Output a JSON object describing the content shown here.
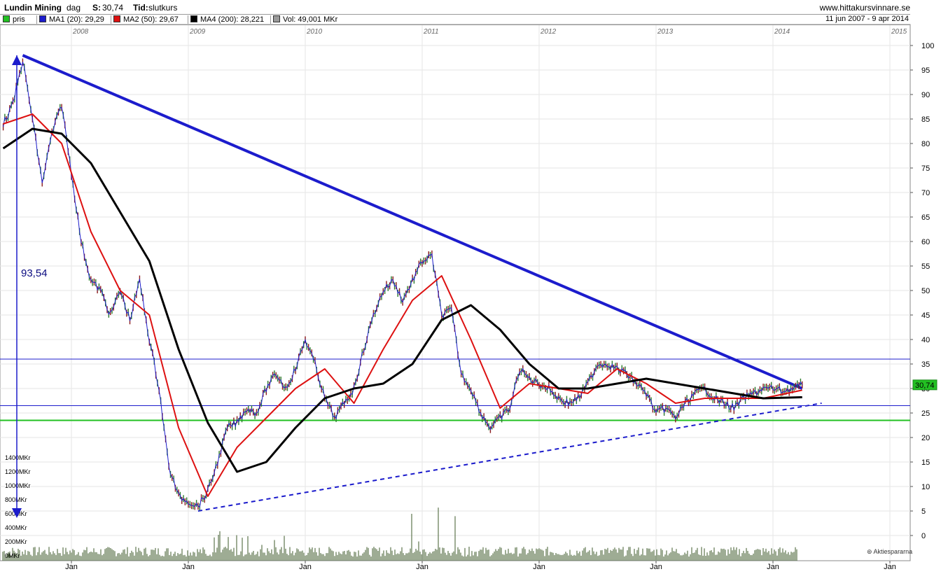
{
  "header": {
    "stock": "Lundin Mining",
    "period": "dag",
    "s_label": "S:",
    "s_value": "30,74",
    "tid_label": "Tid:",
    "tid_value": "slutkurs",
    "site": "www.hittakursvinnare.se",
    "date_range": "11 jun 2007 - 9 apr 2014"
  },
  "legend": [
    {
      "label": "pris",
      "color": "#22c022"
    },
    {
      "label": "MA1 (20): 29,29",
      "color": "#1c1ccc"
    },
    {
      "label": "MA2 (50): 29,67",
      "color": "#dd1111"
    },
    {
      "label": "MA4 (200): 28,221",
      "color": "#000000"
    },
    {
      "label": "Vol: 49,001 MKr",
      "color": "#9a9a9a"
    }
  ],
  "chart_data": {
    "type": "line",
    "title": "Lundin Mining",
    "y_axis": {
      "range": [
        0,
        100
      ],
      "ticks": [
        0,
        5,
        10,
        15,
        20,
        25,
        30,
        35,
        40,
        45,
        50,
        55,
        60,
        65,
        70,
        75,
        80,
        85,
        90,
        95,
        100
      ],
      "side": "right"
    },
    "year_labels": [
      "2008",
      "2009",
      "2010",
      "2011",
      "2012",
      "2013",
      "2014",
      "2015"
    ],
    "month_labels": [
      "Jan",
      "Jan",
      "Jan",
      "Jan",
      "Jan",
      "Jan",
      "Jan",
      "Jan"
    ],
    "volume_axis_labels": [
      "0MKr",
      "200MKr",
      "400MKr",
      "600MKr",
      "800MKr",
      "1000MKr",
      "1200MKr",
      "1400MKr"
    ],
    "last_price_label": "30,74",
    "measure_label": "93,54",
    "footer_brand": "Aktiespararna",
    "price_series": [
      {
        "x": "2007-06",
        "y": 84
      },
      {
        "x": "2007-07",
        "y": 88
      },
      {
        "x": "2007-08",
        "y": 97
      },
      {
        "x": "2007-09",
        "y": 85
      },
      {
        "x": "2007-10",
        "y": 72
      },
      {
        "x": "2007-11",
        "y": 82
      },
      {
        "x": "2007-12",
        "y": 88
      },
      {
        "x": "2008-01",
        "y": 74
      },
      {
        "x": "2008-02",
        "y": 60
      },
      {
        "x": "2008-03",
        "y": 52
      },
      {
        "x": "2008-04",
        "y": 50
      },
      {
        "x": "2008-05",
        "y": 45
      },
      {
        "x": "2008-06",
        "y": 50
      },
      {
        "x": "2008-07",
        "y": 44
      },
      {
        "x": "2008-08",
        "y": 52
      },
      {
        "x": "2008-09",
        "y": 40
      },
      {
        "x": "2008-10",
        "y": 30
      },
      {
        "x": "2008-11",
        "y": 14
      },
      {
        "x": "2008-12",
        "y": 8
      },
      {
        "x": "2009-01",
        "y": 7
      },
      {
        "x": "2009-02",
        "y": 6
      },
      {
        "x": "2009-03",
        "y": 9
      },
      {
        "x": "2009-04",
        "y": 15
      },
      {
        "x": "2009-05",
        "y": 22
      },
      {
        "x": "2009-06",
        "y": 23
      },
      {
        "x": "2009-07",
        "y": 26
      },
      {
        "x": "2009-08",
        "y": 25
      },
      {
        "x": "2009-09",
        "y": 30
      },
      {
        "x": "2009-10",
        "y": 33
      },
      {
        "x": "2009-11",
        "y": 30
      },
      {
        "x": "2009-12",
        "y": 34
      },
      {
        "x": "2010-01",
        "y": 40
      },
      {
        "x": "2010-02",
        "y": 35
      },
      {
        "x": "2010-03",
        "y": 28
      },
      {
        "x": "2010-04",
        "y": 24
      },
      {
        "x": "2010-05",
        "y": 27
      },
      {
        "x": "2010-06",
        "y": 30
      },
      {
        "x": "2010-07",
        "y": 38
      },
      {
        "x": "2010-08",
        "y": 45
      },
      {
        "x": "2010-09",
        "y": 50
      },
      {
        "x": "2010-10",
        "y": 52
      },
      {
        "x": "2010-11",
        "y": 48
      },
      {
        "x": "2010-12",
        "y": 52
      },
      {
        "x": "2011-01",
        "y": 56
      },
      {
        "x": "2011-02",
        "y": 57
      },
      {
        "x": "2011-03",
        "y": 45
      },
      {
        "x": "2011-04",
        "y": 46
      },
      {
        "x": "2011-05",
        "y": 33
      },
      {
        "x": "2011-06",
        "y": 30
      },
      {
        "x": "2011-07",
        "y": 25
      },
      {
        "x": "2011-08",
        "y": 22
      },
      {
        "x": "2011-09",
        "y": 24
      },
      {
        "x": "2011-10",
        "y": 26
      },
      {
        "x": "2011-11",
        "y": 34
      },
      {
        "x": "2011-12",
        "y": 32
      },
      {
        "x": "2012-01",
        "y": 31
      },
      {
        "x": "2012-02",
        "y": 30
      },
      {
        "x": "2012-03",
        "y": 28
      },
      {
        "x": "2012-04",
        "y": 27
      },
      {
        "x": "2012-05",
        "y": 28
      },
      {
        "x": "2012-06",
        "y": 31
      },
      {
        "x": "2012-07",
        "y": 35
      },
      {
        "x": "2012-08",
        "y": 35
      },
      {
        "x": "2012-09",
        "y": 34
      },
      {
        "x": "2012-10",
        "y": 33
      },
      {
        "x": "2012-11",
        "y": 31
      },
      {
        "x": "2012-12",
        "y": 29
      },
      {
        "x": "2013-01",
        "y": 25
      },
      {
        "x": "2013-02",
        "y": 26
      },
      {
        "x": "2013-03",
        "y": 24
      },
      {
        "x": "2013-04",
        "y": 27
      },
      {
        "x": "2013-05",
        "y": 29
      },
      {
        "x": "2013-06",
        "y": 30
      },
      {
        "x": "2013-07",
        "y": 28
      },
      {
        "x": "2013-08",
        "y": 27
      },
      {
        "x": "2013-09",
        "y": 26
      },
      {
        "x": "2013-10",
        "y": 28
      },
      {
        "x": "2013-11",
        "y": 29
      },
      {
        "x": "2013-12",
        "y": 30
      },
      {
        "x": "2014-01",
        "y": 30
      },
      {
        "x": "2014-02",
        "y": 29.5
      },
      {
        "x": "2014-03",
        "y": 30
      },
      {
        "x": "2014-04",
        "y": 30.74
      }
    ],
    "series": [
      {
        "name": "MA2 (50)",
        "color": "#dd1111",
        "values": [
          {
            "x": "2007-06",
            "y": 84
          },
          {
            "x": "2007-09",
            "y": 86
          },
          {
            "x": "2007-12",
            "y": 80
          },
          {
            "x": "2008-03",
            "y": 62
          },
          {
            "x": "2008-06",
            "y": 50
          },
          {
            "x": "2008-09",
            "y": 45
          },
          {
            "x": "2008-12",
            "y": 22
          },
          {
            "x": "2009-03",
            "y": 8
          },
          {
            "x": "2009-06",
            "y": 18
          },
          {
            "x": "2009-09",
            "y": 24
          },
          {
            "x": "2009-12",
            "y": 30
          },
          {
            "x": "2010-03",
            "y": 34
          },
          {
            "x": "2010-06",
            "y": 27
          },
          {
            "x": "2010-09",
            "y": 38
          },
          {
            "x": "2010-12",
            "y": 48
          },
          {
            "x": "2011-03",
            "y": 53
          },
          {
            "x": "2011-06",
            "y": 40
          },
          {
            "x": "2011-09",
            "y": 26
          },
          {
            "x": "2011-12",
            "y": 31
          },
          {
            "x": "2012-03",
            "y": 30
          },
          {
            "x": "2012-06",
            "y": 29
          },
          {
            "x": "2012-09",
            "y": 34
          },
          {
            "x": "2012-12",
            "y": 31
          },
          {
            "x": "2013-03",
            "y": 27
          },
          {
            "x": "2013-06",
            "y": 28
          },
          {
            "x": "2013-09",
            "y": 28
          },
          {
            "x": "2013-12",
            "y": 28
          },
          {
            "x": "2014-04",
            "y": 29.67
          }
        ]
      },
      {
        "name": "MA4 (200)",
        "color": "#000000",
        "values": [
          {
            "x": "2007-06",
            "y": 79
          },
          {
            "x": "2007-09",
            "y": 83
          },
          {
            "x": "2007-12",
            "y": 82
          },
          {
            "x": "2008-03",
            "y": 76
          },
          {
            "x": "2008-06",
            "y": 66
          },
          {
            "x": "2008-09",
            "y": 56
          },
          {
            "x": "2008-12",
            "y": 38
          },
          {
            "x": "2009-03",
            "y": 23
          },
          {
            "x": "2009-06",
            "y": 13
          },
          {
            "x": "2009-09",
            "y": 15
          },
          {
            "x": "2009-12",
            "y": 22
          },
          {
            "x": "2010-03",
            "y": 28
          },
          {
            "x": "2010-06",
            "y": 30
          },
          {
            "x": "2010-09",
            "y": 31
          },
          {
            "x": "2010-12",
            "y": 35
          },
          {
            "x": "2011-03",
            "y": 44
          },
          {
            "x": "2011-06",
            "y": 47
          },
          {
            "x": "2011-09",
            "y": 42
          },
          {
            "x": "2011-12",
            "y": 35
          },
          {
            "x": "2012-03",
            "y": 30
          },
          {
            "x": "2012-06",
            "y": 30
          },
          {
            "x": "2012-09",
            "y": 31
          },
          {
            "x": "2012-12",
            "y": 32
          },
          {
            "x": "2013-03",
            "y": 31
          },
          {
            "x": "2013-06",
            "y": 30
          },
          {
            "x": "2013-09",
            "y": 29
          },
          {
            "x": "2013-12",
            "y": 28
          },
          {
            "x": "2014-04",
            "y": 28.22
          }
        ]
      }
    ],
    "trendlines": [
      {
        "kind": "solid",
        "from": {
          "x": "2007-08",
          "y": 98
        },
        "to": {
          "x": "2014-04",
          "y": 30
        }
      },
      {
        "kind": "dashed",
        "from": {
          "x": "2009-02",
          "y": 5
        },
        "to": {
          "x": "2014-06",
          "y": 27
        }
      }
    ],
    "horizontal_lines": [
      {
        "y": 36,
        "color": "#1c1ccc"
      },
      {
        "y": 26.5,
        "color": "#1c1ccc"
      },
      {
        "y": 23.5,
        "color": "#22c022"
      }
    ],
    "grid": true,
    "legend_position": "top"
  }
}
